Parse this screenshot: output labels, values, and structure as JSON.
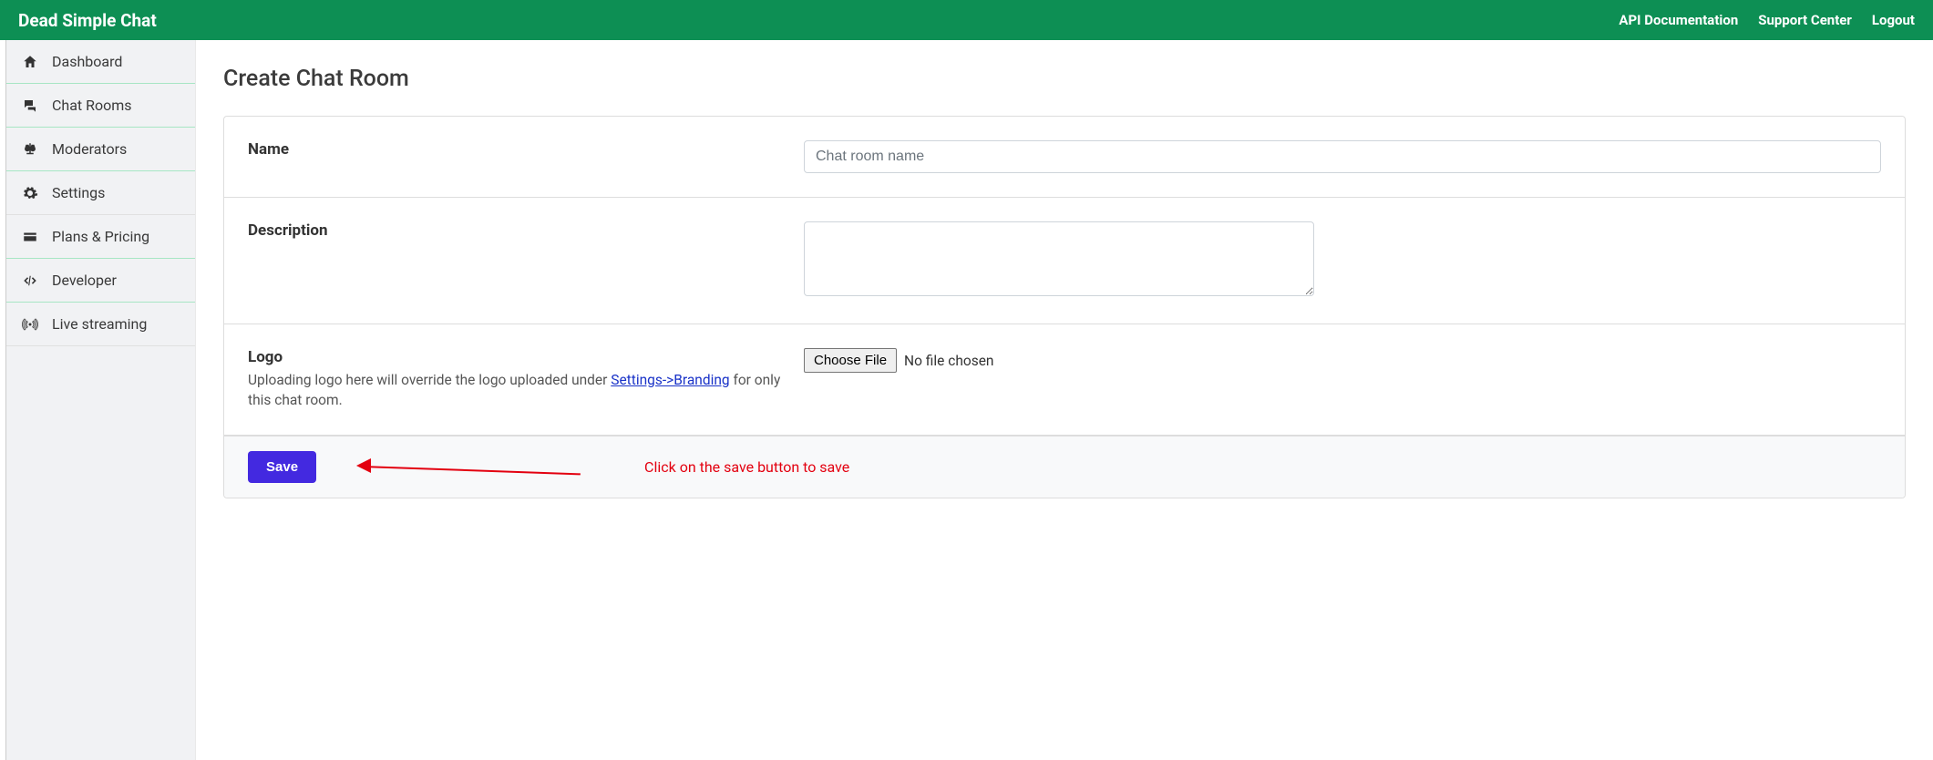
{
  "header": {
    "brand": "Dead Simple Chat",
    "links": {
      "api_docs": "API Documentation",
      "support": "Support Center",
      "logout": "Logout"
    }
  },
  "sidebar": {
    "items": [
      {
        "icon": "home-icon",
        "label": "Dashboard"
      },
      {
        "icon": "chat-icon",
        "label": "Chat Rooms"
      },
      {
        "icon": "scales-icon",
        "label": "Moderators"
      },
      {
        "icon": "gear-icon",
        "label": "Settings"
      },
      {
        "icon": "card-icon",
        "label": "Plans & Pricing"
      },
      {
        "icon": "code-icon",
        "label": "Developer"
      },
      {
        "icon": "broadcast-icon",
        "label": "Live streaming"
      }
    ]
  },
  "page": {
    "title": "Create Chat Room"
  },
  "form": {
    "name": {
      "label": "Name",
      "placeholder": "Chat room name",
      "value": ""
    },
    "description": {
      "label": "Description",
      "value": ""
    },
    "logo": {
      "label": "Logo",
      "help_pre": "Uploading logo here will override the logo uploaded under ",
      "help_link": "Settings->Branding",
      "help_post": " for only this chat room.",
      "choose_btn": "Choose File",
      "status": "No file chosen"
    },
    "save_label": "Save"
  },
  "annotation": {
    "text": "Click on the save button to save",
    "color": "#e3000f"
  }
}
